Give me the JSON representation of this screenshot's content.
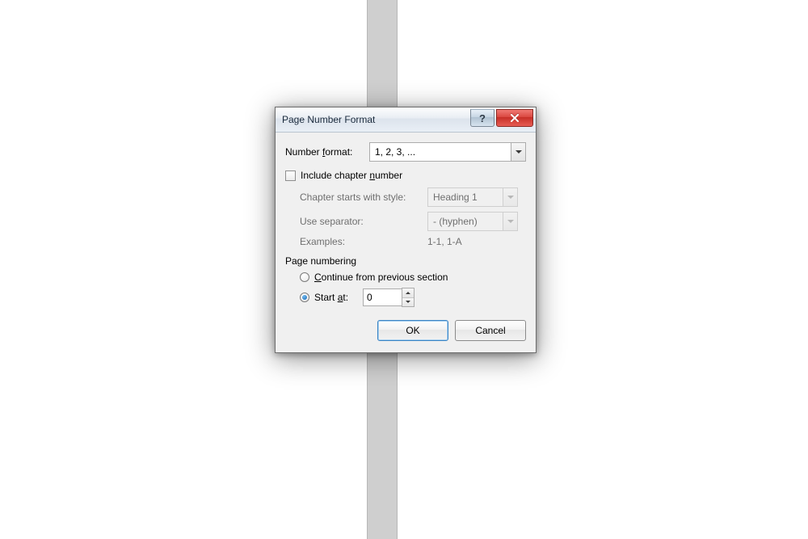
{
  "dialog": {
    "title": "Page Number Format",
    "number_format_label_left": "Number ",
    "number_format_accel": "f",
    "number_format_label_right": "ormat:",
    "number_format_value": "1, 2, 3, ...",
    "include_chapter_label_left": "Include chapter ",
    "include_chapter_accel": "n",
    "include_chapter_label_right": "umber",
    "include_chapter_checked": false,
    "chapter_style_label": "Chapter starts with style:",
    "chapter_style_value": "Heading 1",
    "separator_label": "Use separator:",
    "separator_value": "-   (hyphen)",
    "examples_label": "Examples:",
    "examples_value": "1-1, 1-A",
    "page_numbering_label": "Page numbering",
    "continue_label_accel": "C",
    "continue_label_rest": "ontinue from previous section",
    "continue_selected": false,
    "start_at_label_left": "Start ",
    "start_at_accel": "a",
    "start_at_label_right": "t:",
    "start_at_selected": true,
    "start_at_value": "0",
    "ok_label": "OK",
    "cancel_label": "Cancel"
  }
}
